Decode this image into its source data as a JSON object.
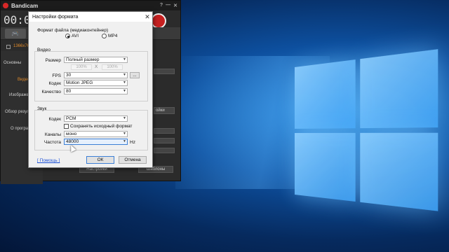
{
  "bandicam": {
    "title": "Bandicam",
    "timer": "00:00",
    "resolution": "1366x76",
    "sidebar": [
      {
        "label": "Основны"
      },
      {
        "label": "Видео",
        "active": true
      },
      {
        "label": "Изображе"
      },
      {
        "label": "Обзор резул"
      },
      {
        "label": "О програм"
      }
    ],
    "bottom_buttons": {
      "settings": "Настройки",
      "templates": "Шаблоны",
      "right_stub": "ойки"
    }
  },
  "dialog": {
    "title": "Настройки формата",
    "container_label": "Формат файла (медиаконтейнер)",
    "format_options": [
      {
        "label": "AVI",
        "selected": true
      },
      {
        "label": "MP4",
        "selected": false
      }
    ],
    "video": {
      "group_label": "Видео",
      "size_label": "Размер",
      "size_value": "Полный размер",
      "scale_w": "100%",
      "scale_x": "X",
      "scale_h": "100%",
      "fps_label": "FPS",
      "fps_value": "30",
      "fps_btn": "...",
      "codec_label": "Кодек",
      "codec_value": "Motion JPEG",
      "quality_label": "Качество",
      "quality_value": "80"
    },
    "audio": {
      "group_label": "Звук",
      "codec_label": "Кодек",
      "codec_value": "PCM",
      "keep_format_label": "Сохранять исходный формат",
      "channels_label": "Каналы",
      "channels_value": "моно",
      "rate_label": "Частота",
      "rate_value": "48000",
      "rate_unit": "Hz"
    },
    "help_link": "[ Помощь ]",
    "ok_label": "ОК",
    "cancel_label": "Отмена"
  },
  "colors": {
    "accent": "#e08a2a",
    "record": "#c62020",
    "desktop": "#0d4f9e"
  }
}
